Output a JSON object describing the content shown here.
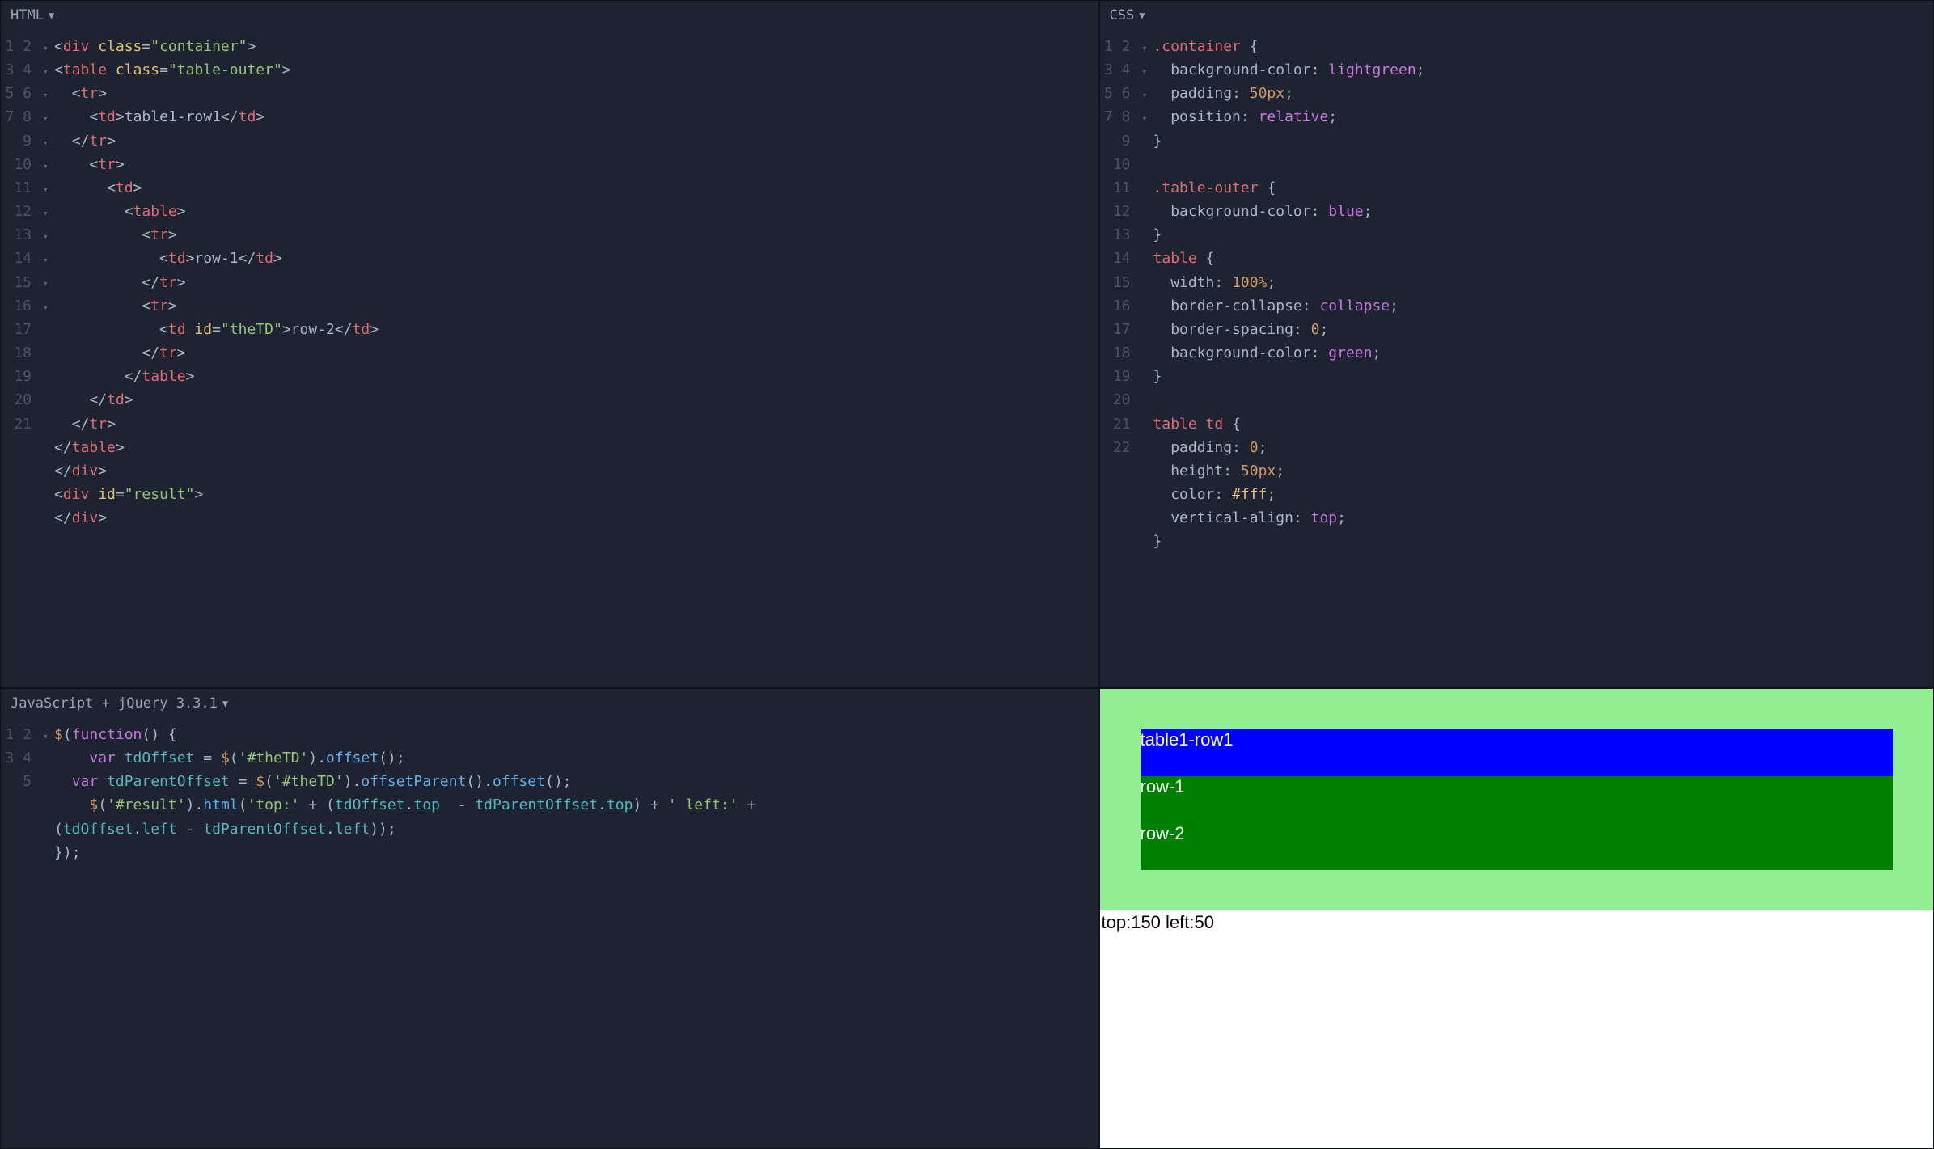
{
  "panes": {
    "html": {
      "title": "HTML"
    },
    "css": {
      "title": "CSS"
    },
    "js": {
      "title": "JavaScript + jQuery 3.3.1"
    }
  },
  "html_editor": {
    "line_numbers": [
      "1",
      "2",
      "3",
      "4",
      "5",
      "6",
      "7",
      "8",
      "9",
      "10",
      "11",
      "12",
      "13",
      "14",
      "15",
      "16",
      "17",
      "18",
      "19",
      "20",
      "21"
    ],
    "fold_markers": [
      "▾",
      "▾",
      "▾",
      "▾",
      "",
      "▾",
      "▾",
      "▾",
      "▾",
      "▾",
      "",
      "▾",
      "▾",
      "",
      "",
      "",
      "",
      "",
      "",
      "▾",
      ""
    ],
    "strings": {
      "container": "\"container\"",
      "table_outer": "\"table-outer\"",
      "the_td": "\"theTD\"",
      "result": "\"result\""
    },
    "text": {
      "t1r1": "table1-row1",
      "row1": "row-1",
      "row2": "row-2"
    }
  },
  "css_editor": {
    "line_numbers": [
      "1",
      "2",
      "3",
      "4",
      "5",
      "6",
      "7",
      "8",
      "9",
      "10",
      "11",
      "12",
      "13",
      "14",
      "15",
      "16",
      "17",
      "18",
      "19",
      "20",
      "21",
      "22"
    ],
    "fold_markers": [
      "▾",
      "",
      "",
      "",
      "",
      "",
      "▾",
      "",
      "",
      "▾",
      "",
      "",
      "",
      "",
      "",
      "",
      "▾",
      "",
      "",
      "",
      "",
      ""
    ],
    "selectors": {
      "container": ".container",
      "table_outer": ".table-outer",
      "table": "table",
      "table_td": "table td"
    },
    "props": {
      "bgcolor": "background-color",
      "padding": "padding",
      "position": "position",
      "width": "width",
      "collapse": "border-collapse",
      "spacing": "border-spacing",
      "height": "height",
      "color": "color",
      "valign": "vertical-align"
    },
    "vals": {
      "lightgreen": "lightgreen",
      "px50": "50px",
      "relative": "relative",
      "blue": "blue",
      "pct100": "100%",
      "collapse": "collapse",
      "zero": "0",
      "green": "green",
      "fff": "#fff",
      "top": "top"
    }
  },
  "js_editor": {
    "line_numbers": [
      "1",
      "2",
      "3",
      "4",
      "",
      "5"
    ],
    "fold_markers": [
      "▾",
      "",
      "",
      "",
      "",
      ""
    ],
    "idents": {
      "tdOffset": "tdOffset",
      "tdParentOffset": "tdParentOffset"
    },
    "strings": {
      "theTD": "'#theTD'",
      "result": "'#result'",
      "top_label": "'top:'",
      "left_label": "' left:'"
    },
    "methods": {
      "offset": "offset",
      "offsetParent": "offsetParent",
      "html": "html",
      "top": "top",
      "left": "left"
    }
  },
  "preview": {
    "table1_row1": "table1-row1",
    "row1": "row-1",
    "row2": "row-2",
    "result": "top:150 left:50"
  }
}
